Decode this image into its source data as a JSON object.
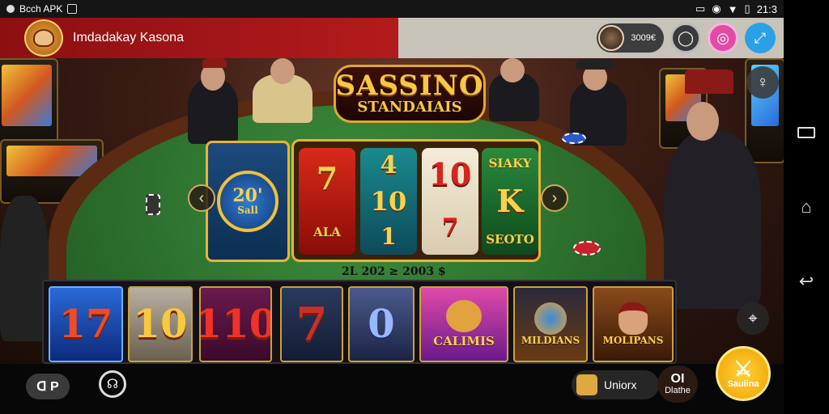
{
  "status_bar": {
    "app_label": "Bcch APK",
    "time": "21:3",
    "icons": [
      "notification-icon",
      "location-icon",
      "wifi-icon",
      "battery-icon"
    ]
  },
  "header": {
    "title": "Imdadakay Kasona",
    "profile_value": "3009€",
    "buttons": [
      "refresh-icon",
      "coin-icon",
      "expand-icon"
    ],
    "colors": {
      "left": "#b31b1b",
      "right": "#c8c3b9",
      "coin_button": "#e24aa8",
      "expand_button": "#2aa0e6"
    }
  },
  "game": {
    "logo_line1": "SASSINO",
    "logo_line2": "STANDAIAIS",
    "bonus_line1": "20'",
    "bonus_line2": "Sall",
    "reels": [
      {
        "top": "7",
        "bottom": "ALA"
      },
      {
        "top": "4",
        "mid": "10",
        "bottom": "1"
      },
      {
        "top": "10",
        "bottom": "7"
      },
      {
        "top": "SIAKY",
        "mid": "K",
        "bottom": "SEOTO"
      }
    ],
    "win_line": "2L 202 ≥ 2003 $"
  },
  "strip": {
    "tiles": [
      {
        "label": "17",
        "caption": ""
      },
      {
        "label": "10",
        "caption": ""
      },
      {
        "label": "110",
        "caption": ""
      },
      {
        "label": "7",
        "caption": ""
      },
      {
        "label": "0",
        "caption": ""
      },
      {
        "label": "",
        "caption": "CALIMIS"
      },
      {
        "label": "",
        "caption": "MILDIANS"
      },
      {
        "label": "",
        "caption": "MOLIPANS"
      }
    ]
  },
  "bottom_bar": {
    "left_pill": "ᗡ P",
    "union_label": "Uniorx",
    "dice_number": "OI",
    "dice_label": "Dlathe",
    "action_label": "Sauiina"
  }
}
